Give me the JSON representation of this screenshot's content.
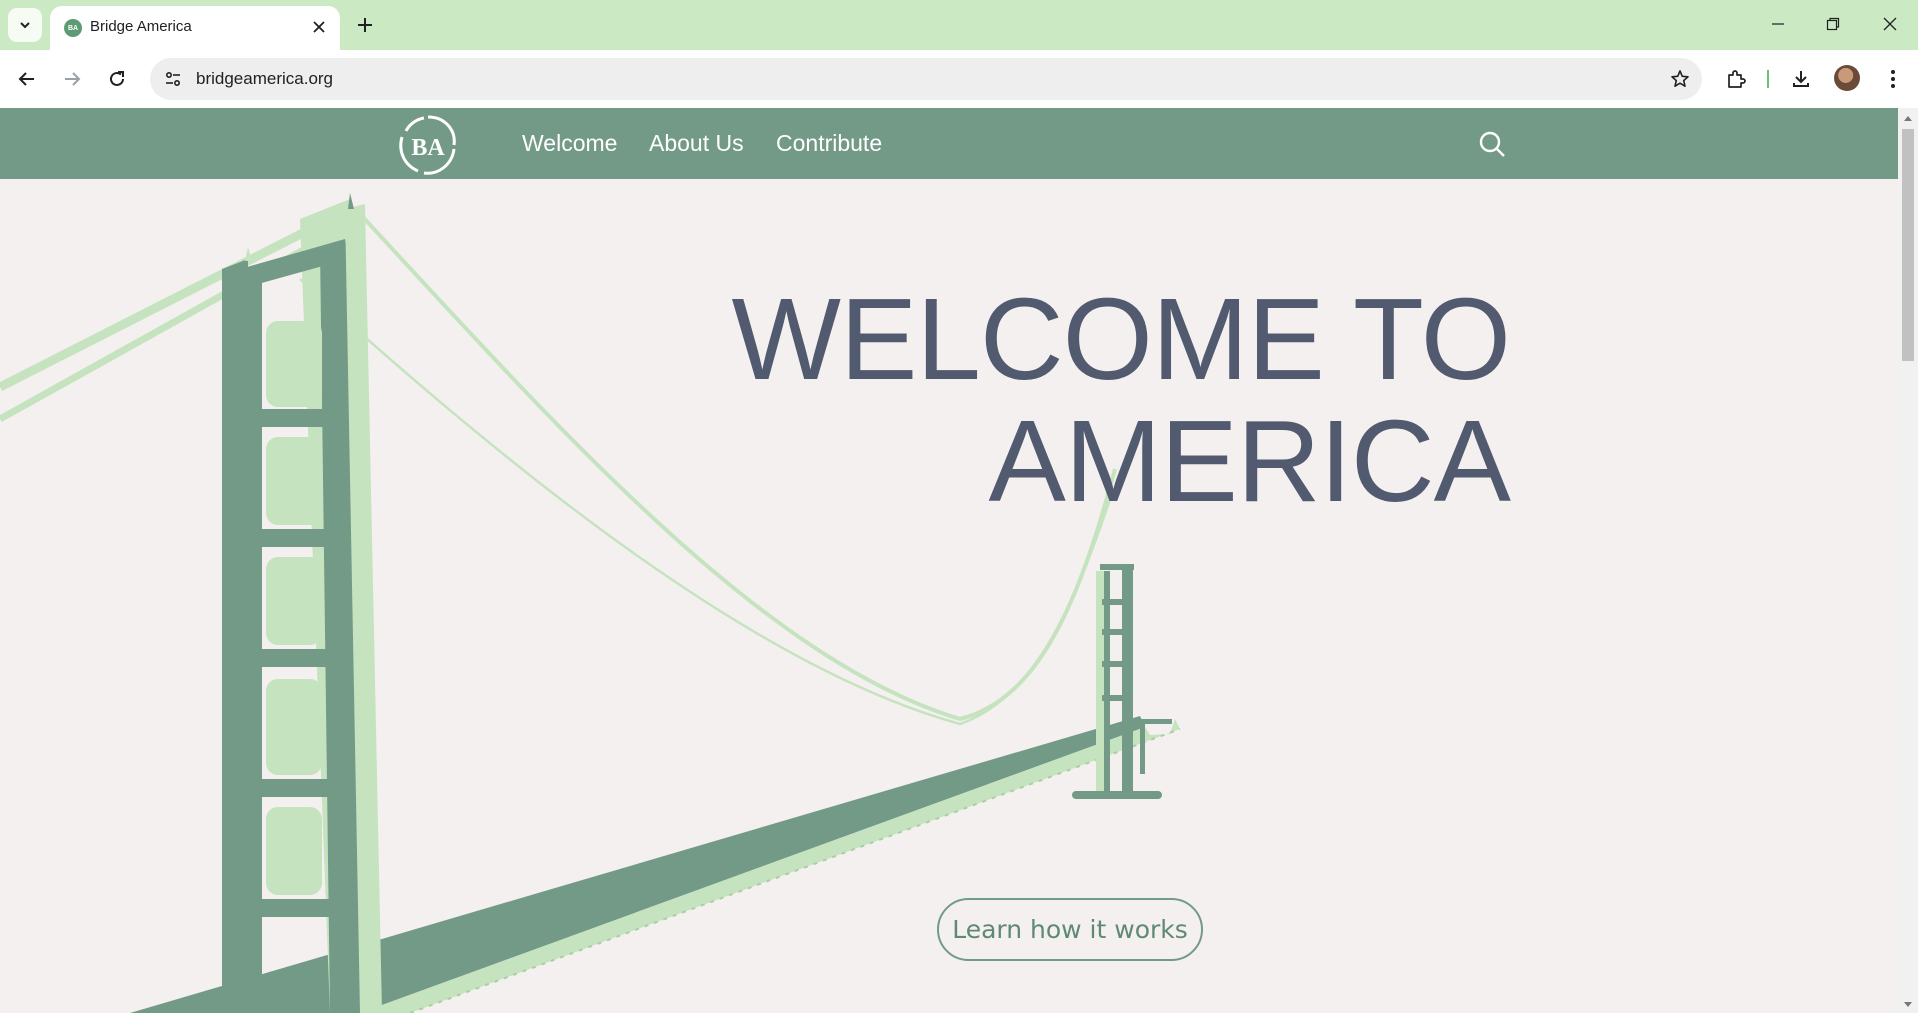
{
  "browser": {
    "tab_title": "Bridge America",
    "favicon_text": "BA",
    "url": "bridgeamerica.org"
  },
  "site": {
    "logo_text": "BA",
    "nav": [
      "Welcome",
      "About Us",
      "Contribute"
    ],
    "hero_title_line1": "WELCOME TO",
    "hero_title_line2": "AMERICA",
    "cta_label": "Learn how it works"
  },
  "colors": {
    "nav_bg": "#739a87",
    "bridge_light": "#c6e3bf",
    "bridge_dark": "#739a87",
    "hero_text": "#525a70",
    "page_bg": "#f4f0f0",
    "tabstrip_bg": "#cbe9c2"
  },
  "icons": [
    "chevron-down-icon",
    "close-icon",
    "plus-icon",
    "minimize-icon",
    "restore-icon",
    "back-icon",
    "forward-icon",
    "reload-icon",
    "site-info-icon",
    "star-icon",
    "extensions-icon",
    "download-icon",
    "kebab-menu-icon",
    "search-icon"
  ]
}
